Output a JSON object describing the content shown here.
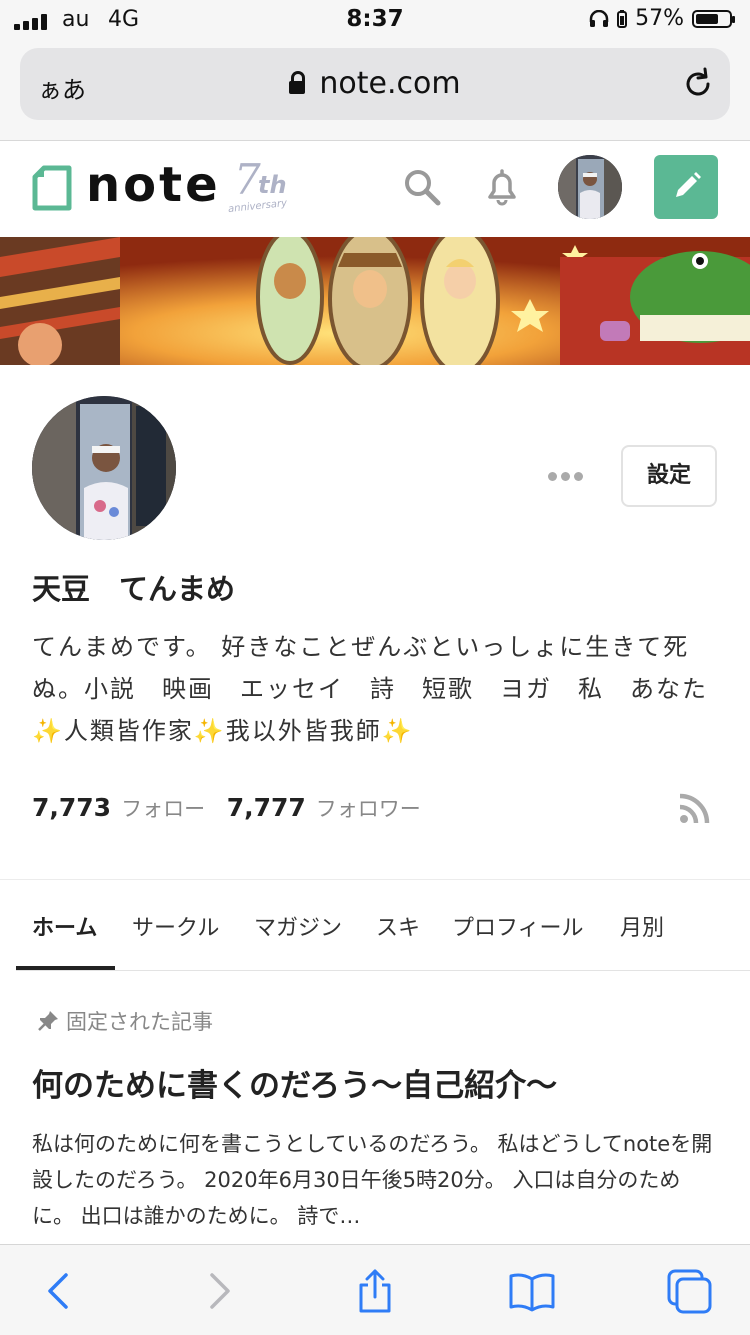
{
  "status_bar": {
    "carrier": "au",
    "network": "4G",
    "time": "8:37",
    "battery": "57%"
  },
  "browser": {
    "aa_label": "ぁあ",
    "url": "note.com"
  },
  "header": {
    "logo_text": "note",
    "anniversary_seven": "7",
    "anniversary_th": "th",
    "anniversary_word": "anniversary",
    "accent_color": "#5bb894"
  },
  "profile": {
    "name": "天豆　てんまめ",
    "bio": "てんまめです。 好きなことぜんぶといっしょに生きて死ぬ。小説　映画　エッセイ　詩　短歌　ヨガ　私　あなた　✨人類皆作家✨我以外皆我師✨",
    "settings_label": "設定",
    "following_count": "7,773",
    "following_label": "フォロー",
    "followers_count": "7,777",
    "followers_label": "フォロワー"
  },
  "tabs": [
    {
      "label": "ホーム"
    },
    {
      "label": "サークル"
    },
    {
      "label": "マガジン"
    },
    {
      "label": "スキ"
    },
    {
      "label": "プロフィール"
    },
    {
      "label": "月別"
    }
  ],
  "pinned": {
    "label": "固定された記事",
    "title": "何のために書くのだろう〜自己紹介〜",
    "excerpt": "私は何のために何を書こうとしているのだろう。 私はどうしてnoteを開設したのだろう。 2020年6月30日午後5時20分。 入口は自分のために。 出口は誰かのために。 詩で…"
  }
}
